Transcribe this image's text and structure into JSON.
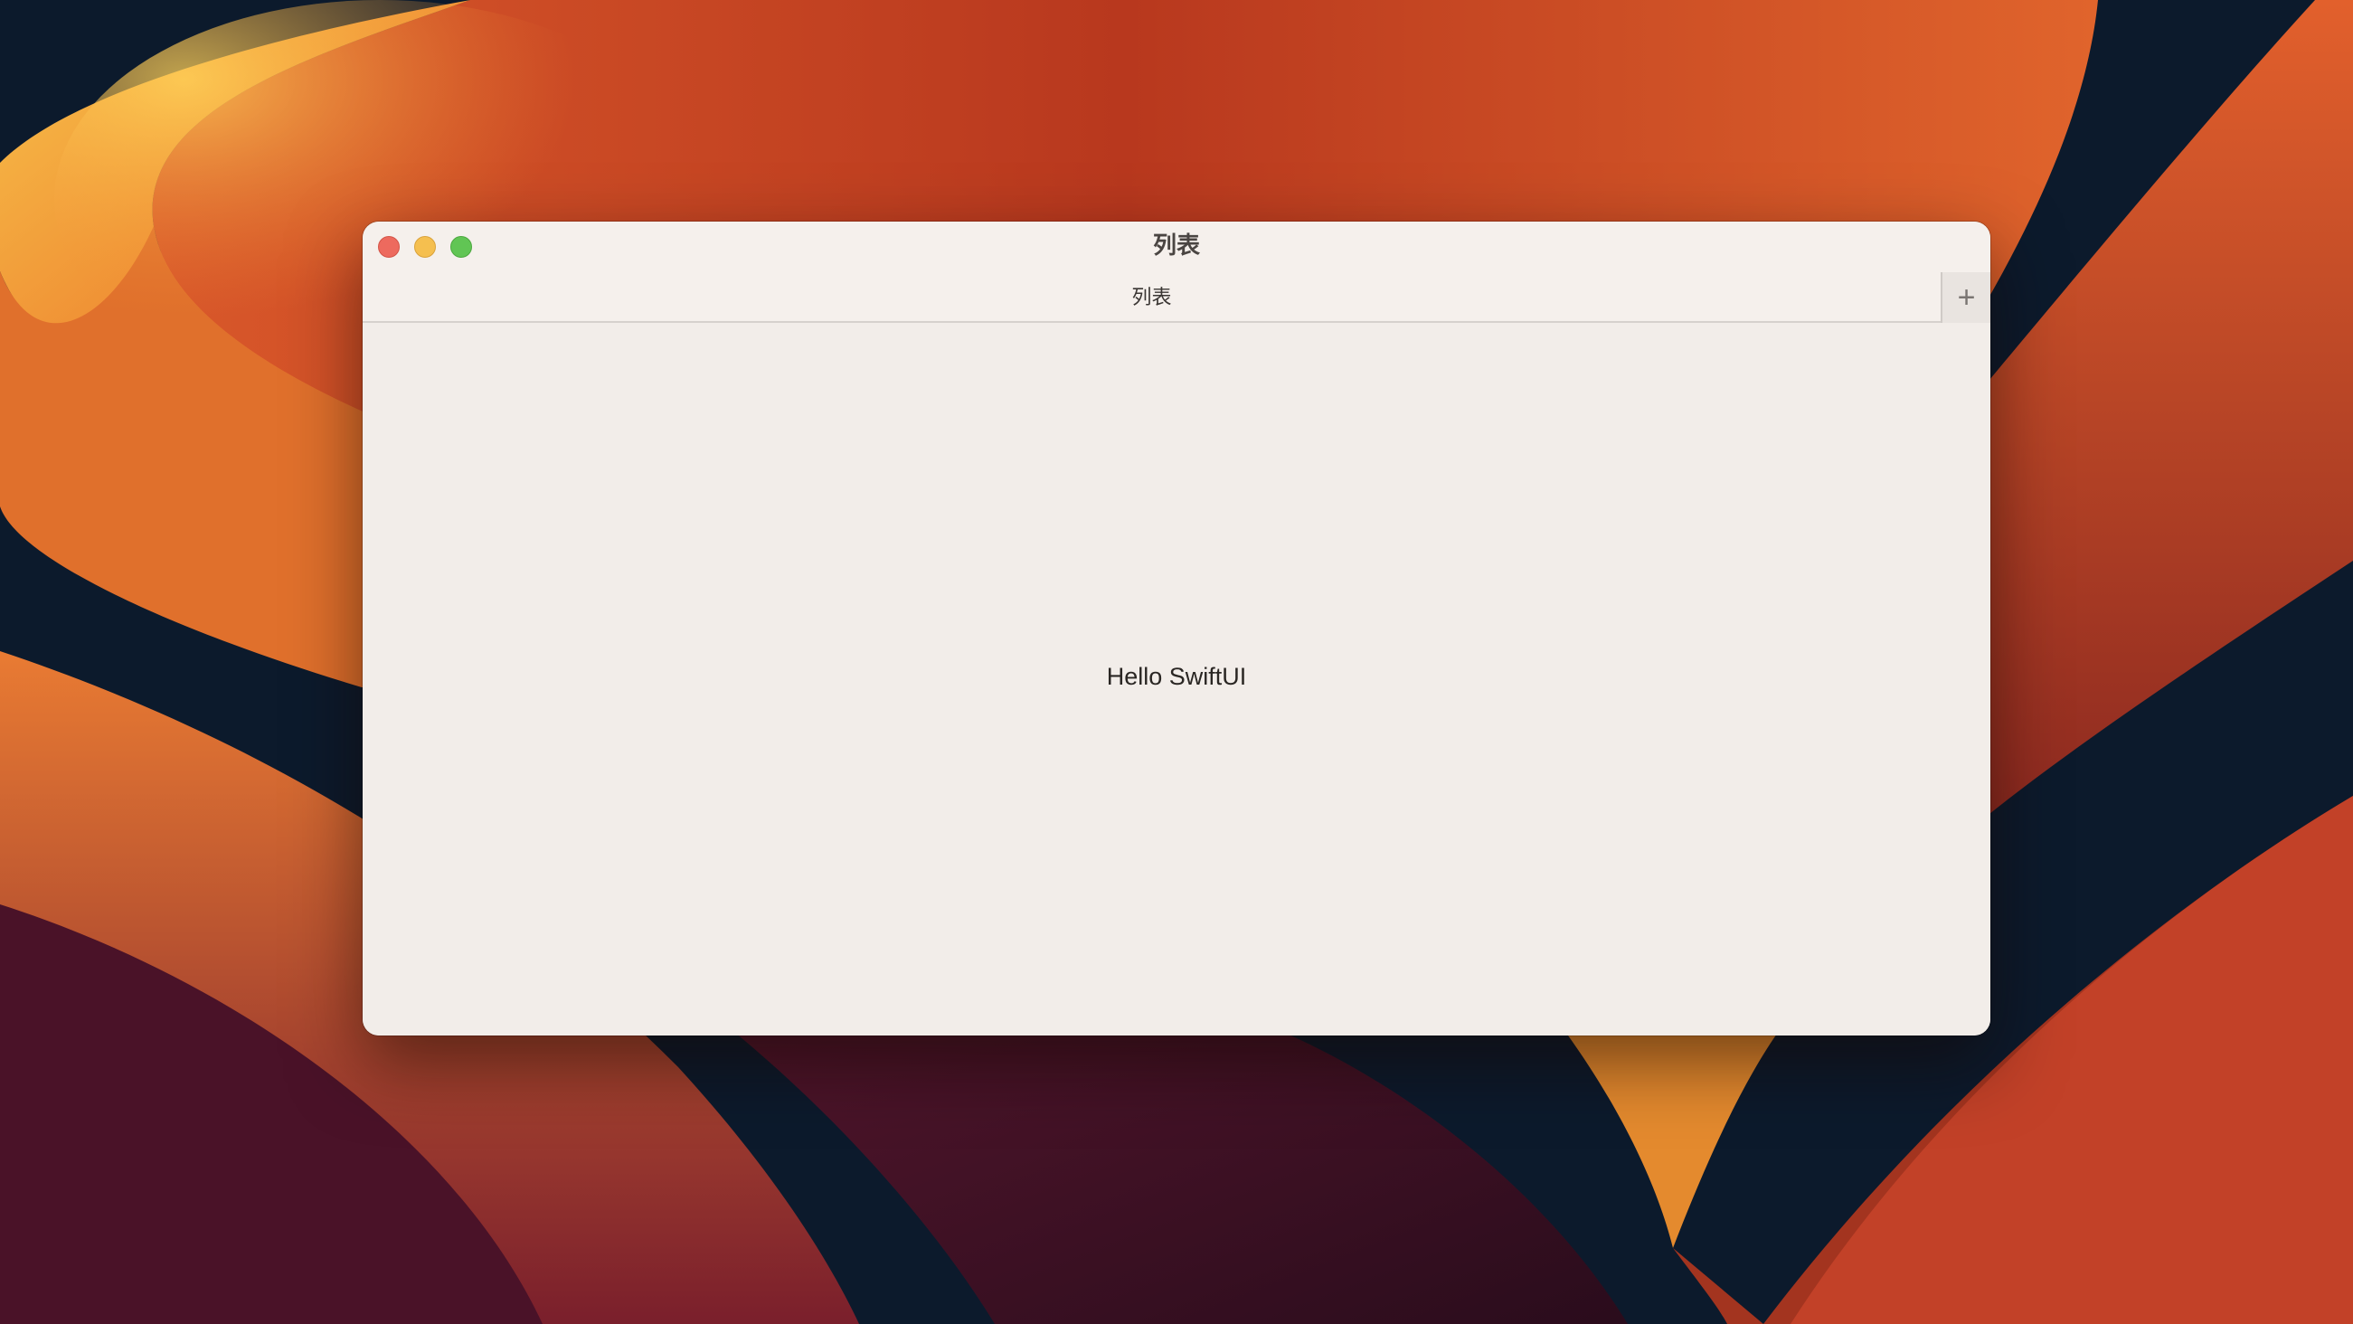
{
  "window": {
    "title": "列表",
    "tab_title": "列表",
    "add_tab_label": "+"
  },
  "content": {
    "text": "Hello SwiftUI"
  },
  "icons": {
    "close": "close-icon",
    "minimize": "minimize-icon",
    "zoom": "zoom-icon",
    "add": "plus-icon"
  },
  "colors": {
    "close": "#ed6a5e",
    "minimize": "#f5bf4f",
    "zoom": "#61c554",
    "window_bg": "#f2ede9"
  }
}
